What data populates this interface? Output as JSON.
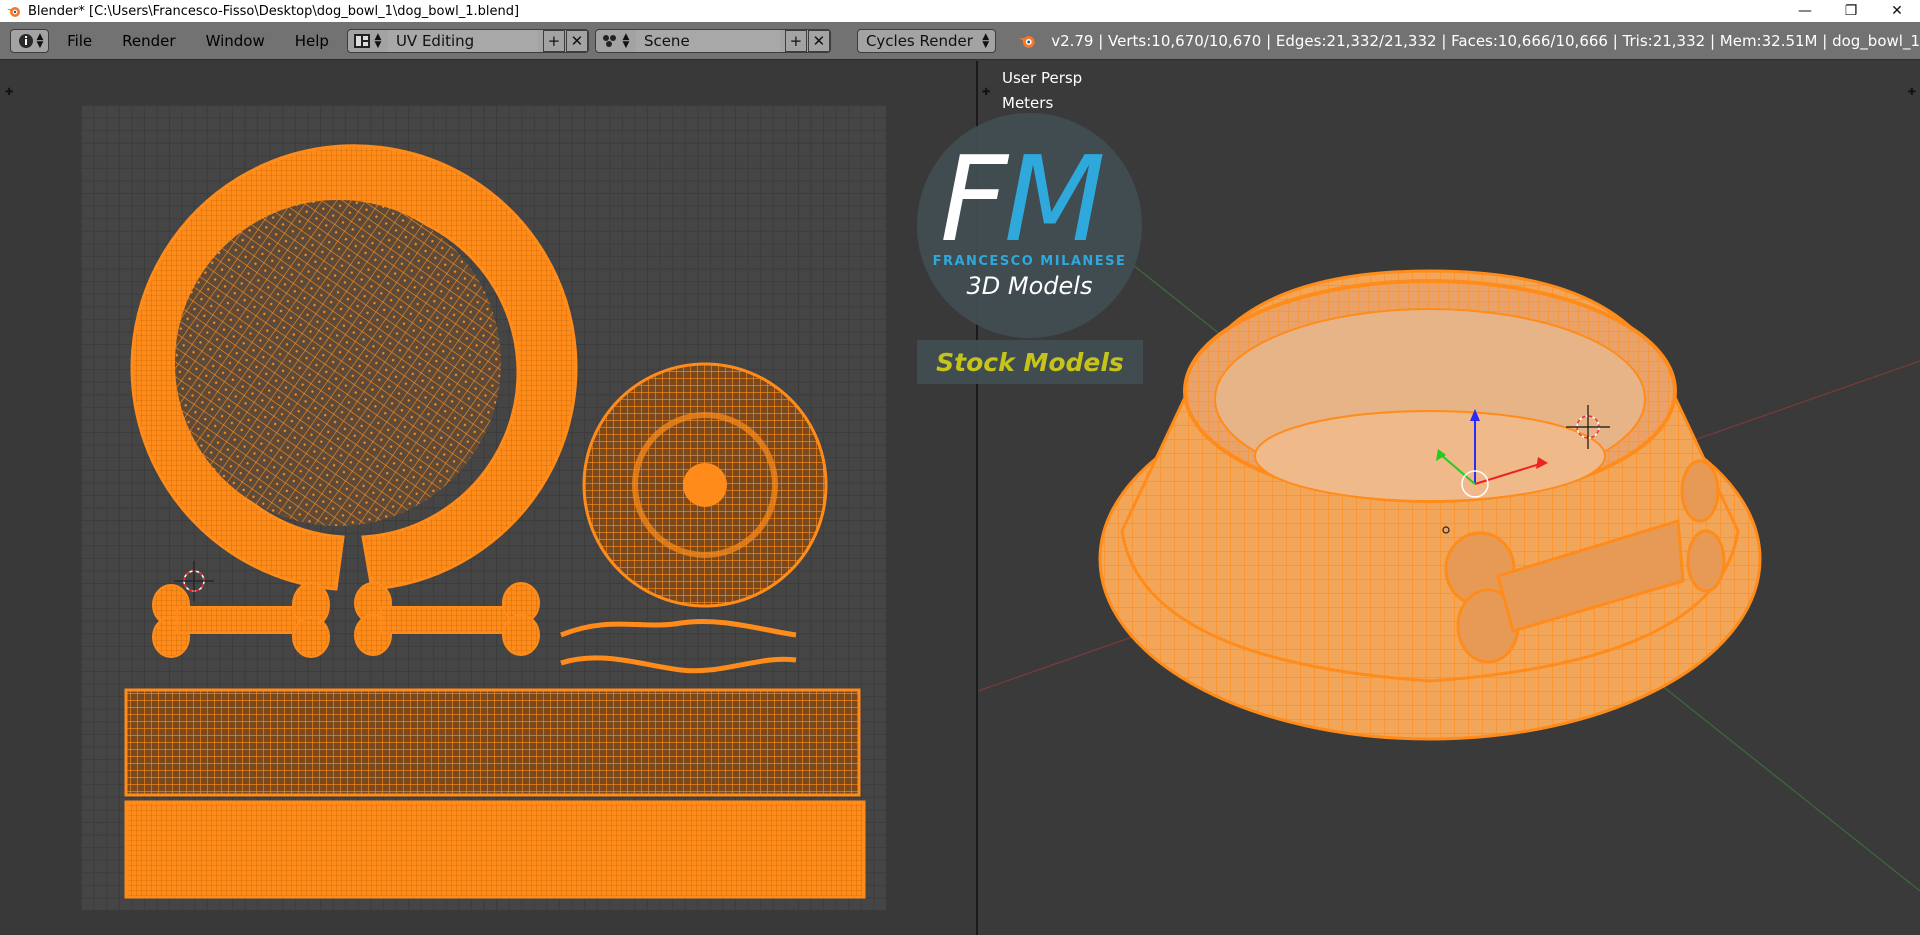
{
  "window": {
    "title": "Blender* [C:\\Users\\Francesco-Fisso\\Desktop\\dog_bowl_1\\dog_bowl_1.blend]",
    "controls": {
      "minimize": "—",
      "restore": "❐",
      "close": "✕"
    }
  },
  "header": {
    "menu": [
      "File",
      "Render",
      "Window",
      "Help"
    ],
    "layout": {
      "value": "UV Editing",
      "add": "+",
      "remove": "✕"
    },
    "scene": {
      "value": "Scene",
      "add": "+",
      "remove": "✕"
    },
    "engine": "Cycles Render",
    "stats": "v2.79 | Verts:10,670/10,670 | Edges:21,332/21,332 | Faces:10,666/10,666 | Tris:21,332 | Mem:32.51M | dog_bowl_1"
  },
  "viewport": {
    "view_label": "User Persp",
    "units_label": "Meters"
  },
  "watermark": {
    "letters_f": "F",
    "letters_m": "M",
    "name": "FRANCESCO MILANESE",
    "tagline": "3D Models",
    "stock": "Stock Models"
  },
  "colors": {
    "mesh": "#ff8c1a",
    "mesh_dark": "#b35a00",
    "header_bg": "#727272",
    "panel_bg": "#393939",
    "accent_blue": "#2fa8dc",
    "accent_yellow": "#c6c419"
  },
  "icons": [
    "info-icon",
    "screen-layout-icon",
    "scene-icon",
    "blender-logo-icon",
    "cursor-icon"
  ]
}
